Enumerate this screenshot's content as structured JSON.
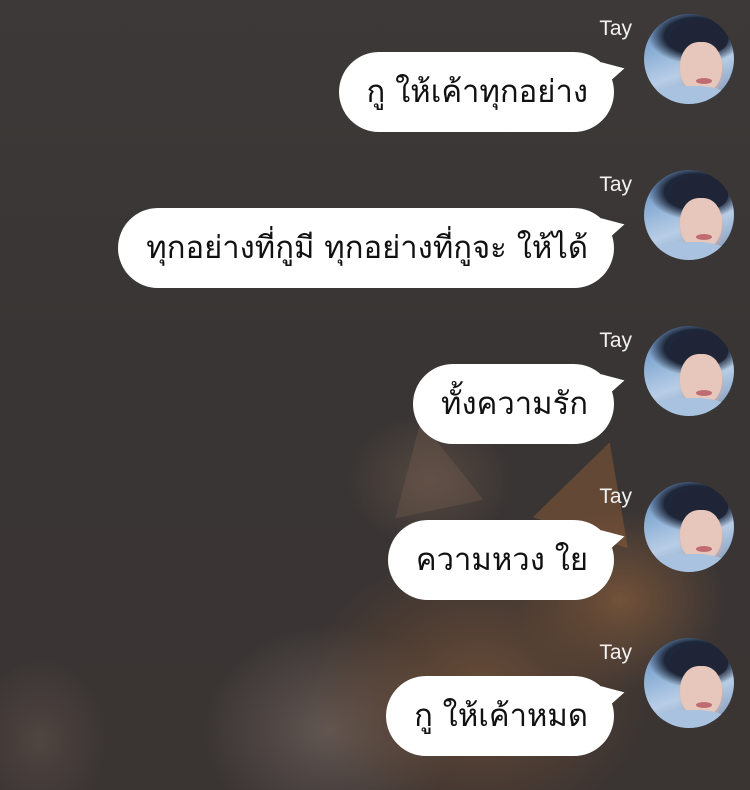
{
  "chat": {
    "messages": [
      {
        "sender": "Tay",
        "text": "กู ให้เค้าทุกอย่าง"
      },
      {
        "sender": "Tay",
        "text": "ทุกอย่างที่กูมี ทุกอย่างที่กูจะ ให้ได้"
      },
      {
        "sender": "Tay",
        "text": "ทั้งความรัก"
      },
      {
        "sender": "Tay",
        "text": "ความหวง ใย"
      },
      {
        "sender": "Tay",
        "text": "กู ให้เค้าหมด"
      }
    ]
  },
  "colors": {
    "background": "#3a3635",
    "bubble": "#ffffff",
    "bubble_text": "#111111",
    "sender_name": "#f2f2f2"
  },
  "icons": {
    "avatar": "profile-photo"
  }
}
